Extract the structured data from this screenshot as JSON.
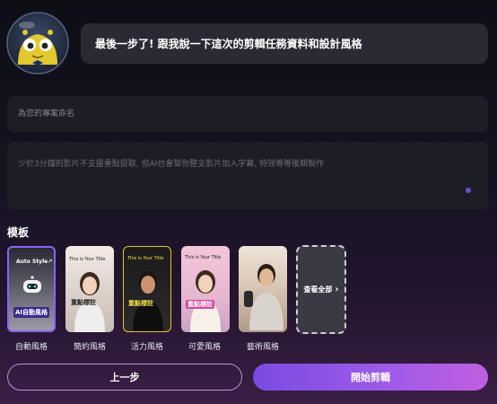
{
  "chat": {
    "message": "最後一步了! 跟我說一下這次的剪輯任務資料和設計風格"
  },
  "form": {
    "project_name_placeholder": "為您的專案命名",
    "description_placeholder": "少於3分鐘的影片不支援重點提取, 但AI也會幫你整支影片加入字幕, 特效等等後期製作"
  },
  "templates": {
    "title": "模板",
    "items": [
      {
        "label": "自動風格",
        "selected": true,
        "overlay_top": "Auto Style↗",
        "overlay_main": "AI自動風格"
      },
      {
        "label": "簡約風格",
        "selected": false,
        "overlay_top": "This is Your Title",
        "overlay_main": "重點標註"
      },
      {
        "label": "活力風格",
        "selected": false,
        "overlay_top": "This is Your Title",
        "overlay_main": "重點標註"
      },
      {
        "label": "可愛風格",
        "selected": false,
        "overlay_top": "This is Your Title",
        "overlay_main": "重點標註"
      },
      {
        "label": "藝術風格",
        "selected": false,
        "overlay_top": "",
        "overlay_main": ""
      }
    ],
    "view_all": "查看全部",
    "view_all_icon": "chevron-right-icon"
  },
  "actions": {
    "back_label": "上一步",
    "start_label": "開始剪輯"
  },
  "colors": {
    "accent": "#8a63f4",
    "start_gradient": [
      "#7a4be2",
      "#c15ee0"
    ]
  }
}
